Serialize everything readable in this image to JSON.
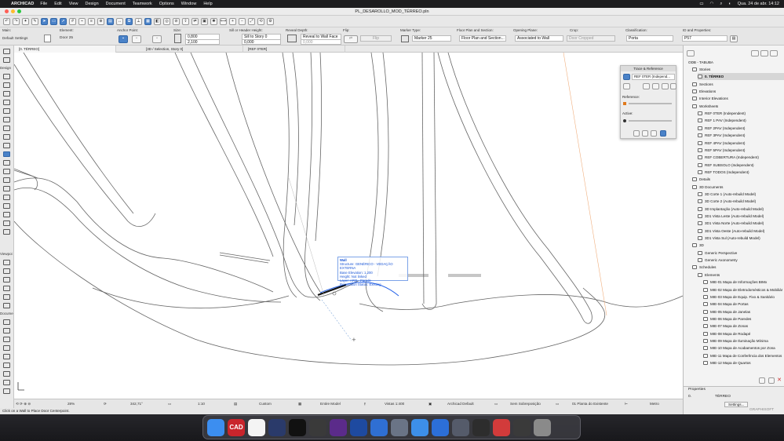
{
  "menubar": {
    "app": "ARCHICAD",
    "items": [
      "File",
      "Edit",
      "View",
      "Design",
      "Document",
      "Teamwork",
      "Options",
      "Window",
      "Help"
    ],
    "clock": "Qua. 24 de abr.  14:12"
  },
  "window": {
    "title": "PL_DESAROLLO_MOD_TÉRREO.pln"
  },
  "infobox": {
    "main_label": "Main:",
    "settings_label": "Default Settings",
    "element_label": "Element:",
    "element_value": "Door 25",
    "anchor_label": "Anchor Point:",
    "size_label": "Size:",
    "width_value": "0,800",
    "height_value": "2,100",
    "sill_label": "Sill or Header Height:",
    "sill_value": "Sill to Story 0",
    "sill_height": "0,000",
    "reveal_label": "Reveal Depth:",
    "reveal_value": "Reveal to Wall Face",
    "reveal_depth": "0,000",
    "flip_label": "Flip:",
    "flip_value": "Flip",
    "marker_label": "Marker Type:",
    "marker_value": "Marker 25",
    "floorplan_label": "Floor Plan and Section:",
    "floorplan_value": "Floor Plan and Section...",
    "opening_label": "Opening Plane:",
    "opening_value": "Associated to Wall",
    "crop_label": "Crop:",
    "crop_value": "Door Cropped",
    "class_label": "Classification:",
    "class_value": "Porta",
    "id_label": "ID and Properties:",
    "id_value": "P57"
  },
  "tabs": [
    "[0. TÉRREO]",
    "[3D / Selection, Story 0]",
    "[REF 0TER]"
  ],
  "toolbox": {
    "categories": [
      "Design",
      "Viewpoi",
      "Docume"
    ]
  },
  "tooltip": {
    "lines": [
      "Wall",
      "Structure: GENÉRICO - VEDAÇÃO EXTERNA",
      "Base Elevation: 1,200",
      "Height: Not linked",
      "Layer: ARQ - Parede",
      "Renovation Status: Existing"
    ]
  },
  "trace": {
    "title": "Trace & Reference",
    "ref_value": "REF 0TER (Independ...",
    "reference_label": "Reference:",
    "active_label": "Active:"
  },
  "navigator": {
    "root": "ODB - TABUBA",
    "items": [
      {
        "label": "Stories",
        "level": 1
      },
      {
        "label": "0. TÉRREO",
        "level": 2,
        "selected": true
      },
      {
        "label": "Sections",
        "level": 1
      },
      {
        "label": "Elevations",
        "level": 1
      },
      {
        "label": "Interior Elevations",
        "level": 1
      },
      {
        "label": "Worksheets",
        "level": 1
      },
      {
        "label": "REF 0TER (Independent)",
        "level": 2
      },
      {
        "label": "REF 1 PAV (Independent)",
        "level": 2
      },
      {
        "label": "REF 2PAV (Independent)",
        "level": 2
      },
      {
        "label": "REF 3PAV (Independent)",
        "level": 2
      },
      {
        "label": "REF 4PAV (Independent)",
        "level": 2
      },
      {
        "label": "REF 5PAV (Independent)",
        "level": 2
      },
      {
        "label": "REF COBERTURA (Independent)",
        "level": 2
      },
      {
        "label": "REF SUBSOLO (Independent)",
        "level": 2
      },
      {
        "label": "REF TODOS (Independent)",
        "level": 2
      },
      {
        "label": "Details",
        "level": 1
      },
      {
        "label": "3D Documents",
        "level": 1
      },
      {
        "label": "3D Corte 1 (Auto-rebuild Model)",
        "level": 2
      },
      {
        "label": "3D Corte 2 (Auto-rebuild Model)",
        "level": 2
      },
      {
        "label": "3D Implantação (Auto-rebuild Model)",
        "level": 2
      },
      {
        "label": "3D1 Vista Leste (Auto-rebuild Model)",
        "level": 2
      },
      {
        "label": "3D1 Vista Norte (Auto-rebuild Model)",
        "level": 2
      },
      {
        "label": "3D1 Vista Oeste (Auto-rebuild Model)",
        "level": 2
      },
      {
        "label": "3D1 Vista Sul (Auto-rebuild Model)",
        "level": 2
      },
      {
        "label": "3D",
        "level": 1
      },
      {
        "label": "Generic Perspective",
        "level": 2
      },
      {
        "label": "Generic Axonometry",
        "level": 2
      },
      {
        "label": "Schedules",
        "level": 1
      },
      {
        "label": "Elements",
        "level": 2
      },
      {
        "label": "MIE-01 Mapa de Informações BIMx",
        "level": 3
      },
      {
        "label": "MIE-02 Mapa de Eletrodomésticos & Mobiliár",
        "level": 3
      },
      {
        "label": "MIE-03 Mapa de Equip. Fixo & Sanitário",
        "level": 3
      },
      {
        "label": "MIE-04 Mapa de Portas",
        "level": 3
      },
      {
        "label": "MIE-05 Mapa de Janelas",
        "level": 3
      },
      {
        "label": "MIE-06 Mapa de Paredes",
        "level": 3
      },
      {
        "label": "MIE-07 Mapa de Zonas",
        "level": 3
      },
      {
        "label": "MIE-08 Mapa de Rodapé",
        "level": 3
      },
      {
        "label": "MIE-09 Mapa de Iluminação Mínima",
        "level": 3
      },
      {
        "label": "MIE-10 Mapa de Acabamentos por Zona",
        "level": 3
      },
      {
        "label": "MIE-11 Mapa de Conferência dos Elementos",
        "level": 3
      },
      {
        "label": "MIE-12 Mapa de Quartos",
        "level": 3
      }
    ]
  },
  "properties": {
    "title": "Properties",
    "id": "0.",
    "story": "TÉRREO",
    "settings_button": "Settings...",
    "brand": "GRAPHISOFT"
  },
  "statusbar": {
    "zoom": "28%",
    "angle": "342,71°",
    "scale": "1:10",
    "custom": "Custom",
    "model": "Entire Model",
    "vistas": "Vistas 1:400",
    "archicad": "Archicad Default",
    "sobreposicao": "Sem Sobreposição",
    "planta": "01 Planta do Existente",
    "metro": "Metro"
  },
  "prompt": "Click on a Wall to Place Door Centerpoint.",
  "dock": {
    "apps": [
      {
        "name": "finder",
        "color": "#3c8ef0"
      },
      {
        "name": "autocad",
        "color": "#c9252c",
        "label": "CAD"
      },
      {
        "name": "notion",
        "color": "#f4f4f4"
      },
      {
        "name": "archicad",
        "color": "#2a3a6a"
      },
      {
        "name": "search",
        "color": "#111111"
      },
      {
        "name": "game",
        "color": "#3a3a3a"
      },
      {
        "name": "affinity",
        "color": "#5b2b8a"
      },
      {
        "name": "sketch",
        "color": "#1e4aa0"
      },
      {
        "name": "app-blue",
        "color": "#2f6fd3"
      },
      {
        "name": "photos",
        "color": "#6a7486"
      },
      {
        "name": "safari",
        "color": "#3d8fe8"
      },
      {
        "name": "keynote",
        "color": "#2c6fd8"
      },
      {
        "name": "preview",
        "color": "#555b6a"
      },
      {
        "name": "doc1",
        "color": "#2d2d2d"
      },
      {
        "name": "doc2",
        "color": "#d23b3b"
      },
      {
        "name": "doc3",
        "color": "#3a3a3a"
      },
      {
        "name": "trash",
        "color": "#8a8a8a"
      }
    ]
  }
}
